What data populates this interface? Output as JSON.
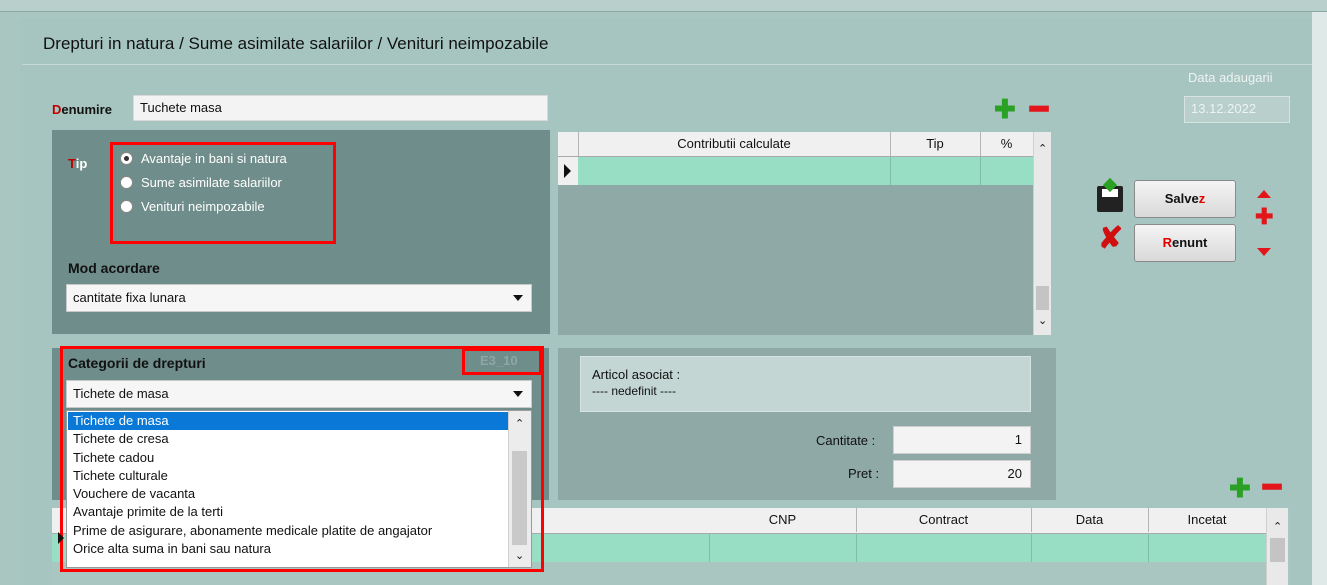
{
  "form": {
    "title": "Drepturi in natura / Sume asimilate salariilor / Venituri neimpozabile",
    "date_label": "Data adaugarii",
    "date_value": "13.12.2022",
    "denumire_label": "Denumire",
    "denumire_value": "Tuchete masa"
  },
  "tip": {
    "label": "Tip",
    "options": [
      {
        "label": "Avantaje in bani si natura",
        "selected": true
      },
      {
        "label": "Sume asimilate salariilor",
        "selected": false
      },
      {
        "label": "Venituri neimpozabile",
        "selected": false
      }
    ]
  },
  "mod_acordare": {
    "label": "Mod acordare",
    "value": "cantitate fixa lunara"
  },
  "contributii_grid": {
    "columns": [
      "Contributii calculate",
      "Tip",
      "%"
    ]
  },
  "buttons": {
    "save": {
      "pre": "Salve",
      "hot": "z"
    },
    "cancel": {
      "hot": "R",
      "post": "enunt"
    }
  },
  "categorii": {
    "label": "Categorii de drepturi",
    "code": "E3_10",
    "value": "Tichete de masa",
    "options": [
      "Tichete de masa",
      "Tichete de cresa",
      "Tichete cadou",
      "Tichete culturale",
      "Vouchere de vacanta",
      "Avantaje primite de la terti",
      "Prime de asigurare, abonamente medicale platite de angajator",
      "Orice alta suma in bani sau natura"
    ],
    "selected_index": 0
  },
  "articol": {
    "label": "Articol asociat :",
    "value": "---- nedefinit ----",
    "cantitate_label": "Cantitate :",
    "cantitate_value": "1",
    "pret_label": "Pret :",
    "pret_value": "20"
  },
  "angajati_grid": {
    "columns": [
      "CNP",
      "Contract",
      "Data",
      "Incetat"
    ]
  },
  "colors": {
    "accent_red": "#ff0000",
    "teal_row": "#97dec4",
    "plus_green": "#2aa125",
    "minus_red": "#e2161a",
    "selection_blue": "#0a78d7"
  }
}
